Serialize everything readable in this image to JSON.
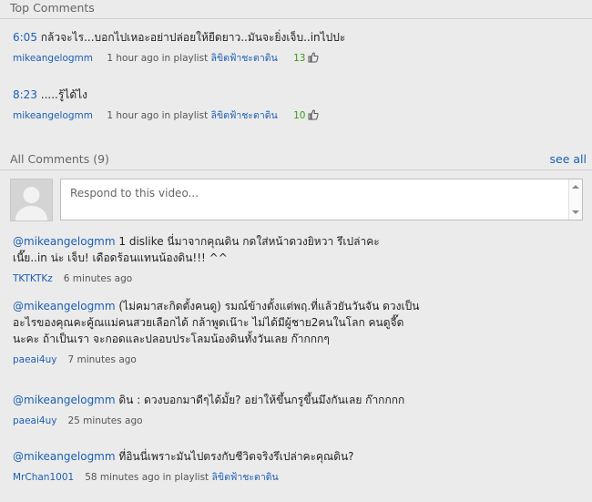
{
  "top_comments": {
    "header": "Top Comments",
    "items": [
      {
        "timestamp": "6:05",
        "text": " กล้วจะไร...บอกไปเหอะอย่าปล่อยให้ยืดยาว..มันจะยิ่งเจ็บ..inไปปะ",
        "author": "mikeangelogmm",
        "time": "1 hour ago",
        "in_playlist": "in playlist",
        "playlist": "ลิขิตฟ้าชะตาดิน",
        "likes": "13"
      },
      {
        "timestamp": "8:23",
        "text": " .....รู้ได้ไง",
        "author": "mikeangelogmm",
        "time": "1 hour ago",
        "in_playlist": "in playlist",
        "playlist": "ลิขิตฟ้าชะตาดิน",
        "likes": "10"
      }
    ]
  },
  "all_comments": {
    "header": "All Comments",
    "count": "(9)",
    "see_all": "see all",
    "reply_placeholder": "Respond to this video...",
    "items": [
      {
        "mention": "@mikeangelogmm",
        "lines": [
          " 1 dislike นี่มาจากคุณดิน กดใส่หน้าดวงยิหวา รึเปล่าคะ",
          "เนี๊ย..in น่ะ เจ็บ! เดือดร้อนแทนน้องดิน!!! ^^"
        ],
        "author": "TKTKTKz",
        "time": "6 minutes ago"
      },
      {
        "mention": "@mikeangelogmm",
        "lines": [
          " (ไม่คมาสะกิดตั้งคนดู) รมณ์ข้างตั้งแต่พฤ.ที่แล้วยันวันจัน ดวงเป็น",
          "อะไรของคุณคะคู้ณแม่คนสวยเลือกได้ กล้าพูดเน๊าะ ไม่ได้มีผู้ชาย2คนในโลก คนดูจี๊ด",
          "นะคะ ถ้าเป็นเรา จะกอดและปลอบประโลมน้องดินทั้งวันเลย ก๊ากกกๆ"
        ],
        "author": "paeai4uy",
        "time": "7 minutes ago"
      },
      {
        "mention": "@mikeangelogmm",
        "lines": [
          " ดิน : ดวงบอกมาดีๆได้มั้ย? อย่าให้ขึ้นกรูขึ้นมึงกันเลย ก๊ากกกก"
        ],
        "author": "paeai4uy",
        "time": "25 minutes ago"
      },
      {
        "mention": "@mikeangelogmm",
        "lines": [
          " ที่อินนี่เพราะมันไปตรงกับชีวิตจริงรึเปล่าคะคุณดิน?"
        ],
        "author": "MrChan1001",
        "time": "58 minutes ago",
        "in_playlist": "in playlist",
        "playlist": "ลิขิตฟ้าชะตาดิน"
      }
    ]
  }
}
